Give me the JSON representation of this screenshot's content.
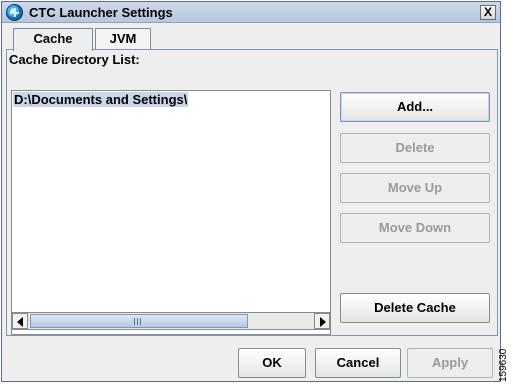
{
  "window": {
    "title": "CTC Launcher Settings",
    "close_label": "X"
  },
  "tabs": [
    {
      "label": "Cache",
      "active": true
    },
    {
      "label": "JVM",
      "active": false
    }
  ],
  "cache": {
    "list_caption": "Cache Directory List:",
    "entries": [
      "D:\\Documents and Settings\\"
    ],
    "buttons": {
      "add": {
        "label": "Add...",
        "enabled": true
      },
      "delete": {
        "label": "Delete",
        "enabled": false
      },
      "move_up": {
        "label": "Move Up",
        "enabled": false
      },
      "move_down": {
        "label": "Move Down",
        "enabled": false
      },
      "delete_cache": {
        "label": "Delete Cache",
        "enabled": true
      }
    }
  },
  "footer": {
    "ok": {
      "label": "OK",
      "enabled": true
    },
    "cancel": {
      "label": "Cancel",
      "enabled": true
    },
    "apply": {
      "label": "Apply",
      "enabled": false
    }
  },
  "figure_id": "159630",
  "icons": {
    "app": "ctc-launcher-globe-icon",
    "close": "close-icon",
    "scroll_left": "scroll-left-arrow-icon",
    "scroll_right": "scroll-right-arrow-icon"
  },
  "colors": {
    "titlebar": "#c4d1e5",
    "selection": "#c9d6ea",
    "disabled_text": "#9a9a9a"
  }
}
